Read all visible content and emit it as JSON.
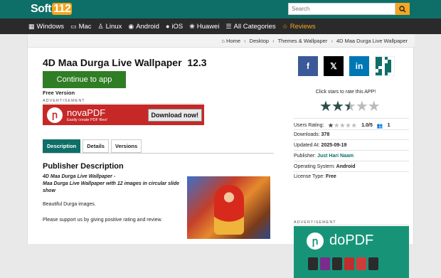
{
  "site": {
    "logo_text": "Soft",
    "logo_num": "112"
  },
  "search": {
    "placeholder": "Search"
  },
  "nav": [
    {
      "label": "Windows",
      "icon": "windows-icon",
      "glyph": "▦"
    },
    {
      "label": "Mac",
      "icon": "mac-icon",
      "glyph": "▭"
    },
    {
      "label": "Linux",
      "icon": "linux-icon",
      "glyph": "♙"
    },
    {
      "label": "Android",
      "icon": "android-icon",
      "glyph": "◉"
    },
    {
      "label": "iOS",
      "icon": "apple-icon",
      "glyph": "●"
    },
    {
      "label": "Huawei",
      "icon": "huawei-icon",
      "glyph": "❀"
    },
    {
      "label": "All Categories",
      "icon": "categories-icon",
      "glyph": "☰"
    },
    {
      "label": "Reviews",
      "icon": "star-icon",
      "glyph": "☆"
    }
  ],
  "breadcrumb": [
    "Home",
    "Desktop",
    "Themes & Wallpaper",
    "4D Maa Durga Live Wallpaper"
  ],
  "app": {
    "name": "4D Maa Durga Live Wallpaper",
    "version": "12.3",
    "license_line": "Free Version"
  },
  "continue_label": "Continue to app",
  "ad_label": "ADVERTISEMENT",
  "ad1": {
    "logo": "ր",
    "name": "novaPDF",
    "tagline": "Easily create PDF files!",
    "cta": "Download now!"
  },
  "tabs": [
    "Description",
    "Details",
    "Versions"
  ],
  "publisher_heading": "Publisher Description",
  "description": {
    "line1": "4D Maa Durga Live Wallpaper -",
    "line2": "Maa Durga Live Wallpaper with 12 images in circular slide show",
    "line3": "Beautiful Durga images.",
    "line4": "Please support us by giving positive rating and review."
  },
  "social": {
    "facebook": "f",
    "x": "𝕏",
    "linkedin": "in"
  },
  "rating": {
    "cta": "Click stars to rate this APP!",
    "score": "1.0/5",
    "votes": "1",
    "stars_big": 2.5,
    "stars_small": 1
  },
  "info": {
    "users_rating_label": "Users Rating:",
    "downloads_label": "Downloads:",
    "downloads": "378",
    "updated_label": "Updated At:",
    "updated": "2025-09-19",
    "publisher_label": "Publisher:",
    "publisher": "Just Hari Naam",
    "os_label": "Operating System:",
    "os": "Android",
    "license_label": "License Type:",
    "license": "Free"
  },
  "ad2": {
    "logo": "ր",
    "name": "doPDF"
  },
  "colors": {
    "brand": "#0e6f68",
    "accent": "#f5a623",
    "button": "#2f7d24",
    "facebook": "#3b5998",
    "x": "#000000",
    "linkedin": "#0077b5"
  }
}
